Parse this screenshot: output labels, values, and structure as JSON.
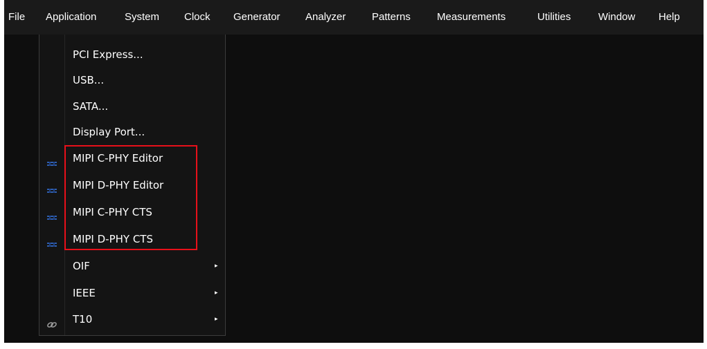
{
  "menubar": {
    "items": [
      "File",
      "Application",
      "System",
      "Clock",
      "Generator",
      "Analyzer",
      "Patterns",
      "Measurements",
      "Utilities",
      "Window",
      "Help"
    ]
  },
  "dropdown": {
    "items": [
      {
        "label": "PCI Express...",
        "icon": null,
        "submenu": false
      },
      {
        "label": "USB...",
        "icon": null,
        "submenu": false
      },
      {
        "label": "SATA...",
        "icon": null,
        "submenu": false
      },
      {
        "label": "Display Port...",
        "icon": null,
        "submenu": false
      },
      {
        "label": "MIPI C-PHY Editor",
        "icon": "mipi-plugin-icon",
        "submenu": false
      },
      {
        "label": "MIPI D-PHY Editor",
        "icon": "mipi-plugin-icon",
        "submenu": false
      },
      {
        "label": "MIPI C-PHY CTS",
        "icon": "mipi-plugin-icon",
        "submenu": false
      },
      {
        "label": "MIPI D-PHY CTS",
        "icon": "mipi-plugin-icon",
        "submenu": false
      },
      {
        "label": "OIF",
        "icon": null,
        "submenu": true
      },
      {
        "label": "IEEE",
        "icon": null,
        "submenu": true
      },
      {
        "label": "T10",
        "icon": "chain-link-icon",
        "submenu": true
      }
    ],
    "submenu_arrow": "▸"
  },
  "colors": {
    "background": "#0e0e0e",
    "menubar": "#1a1a1a",
    "dropdown": "#141414",
    "highlight_box": "#e8101a",
    "icon_blue": "#2f5fb0"
  }
}
